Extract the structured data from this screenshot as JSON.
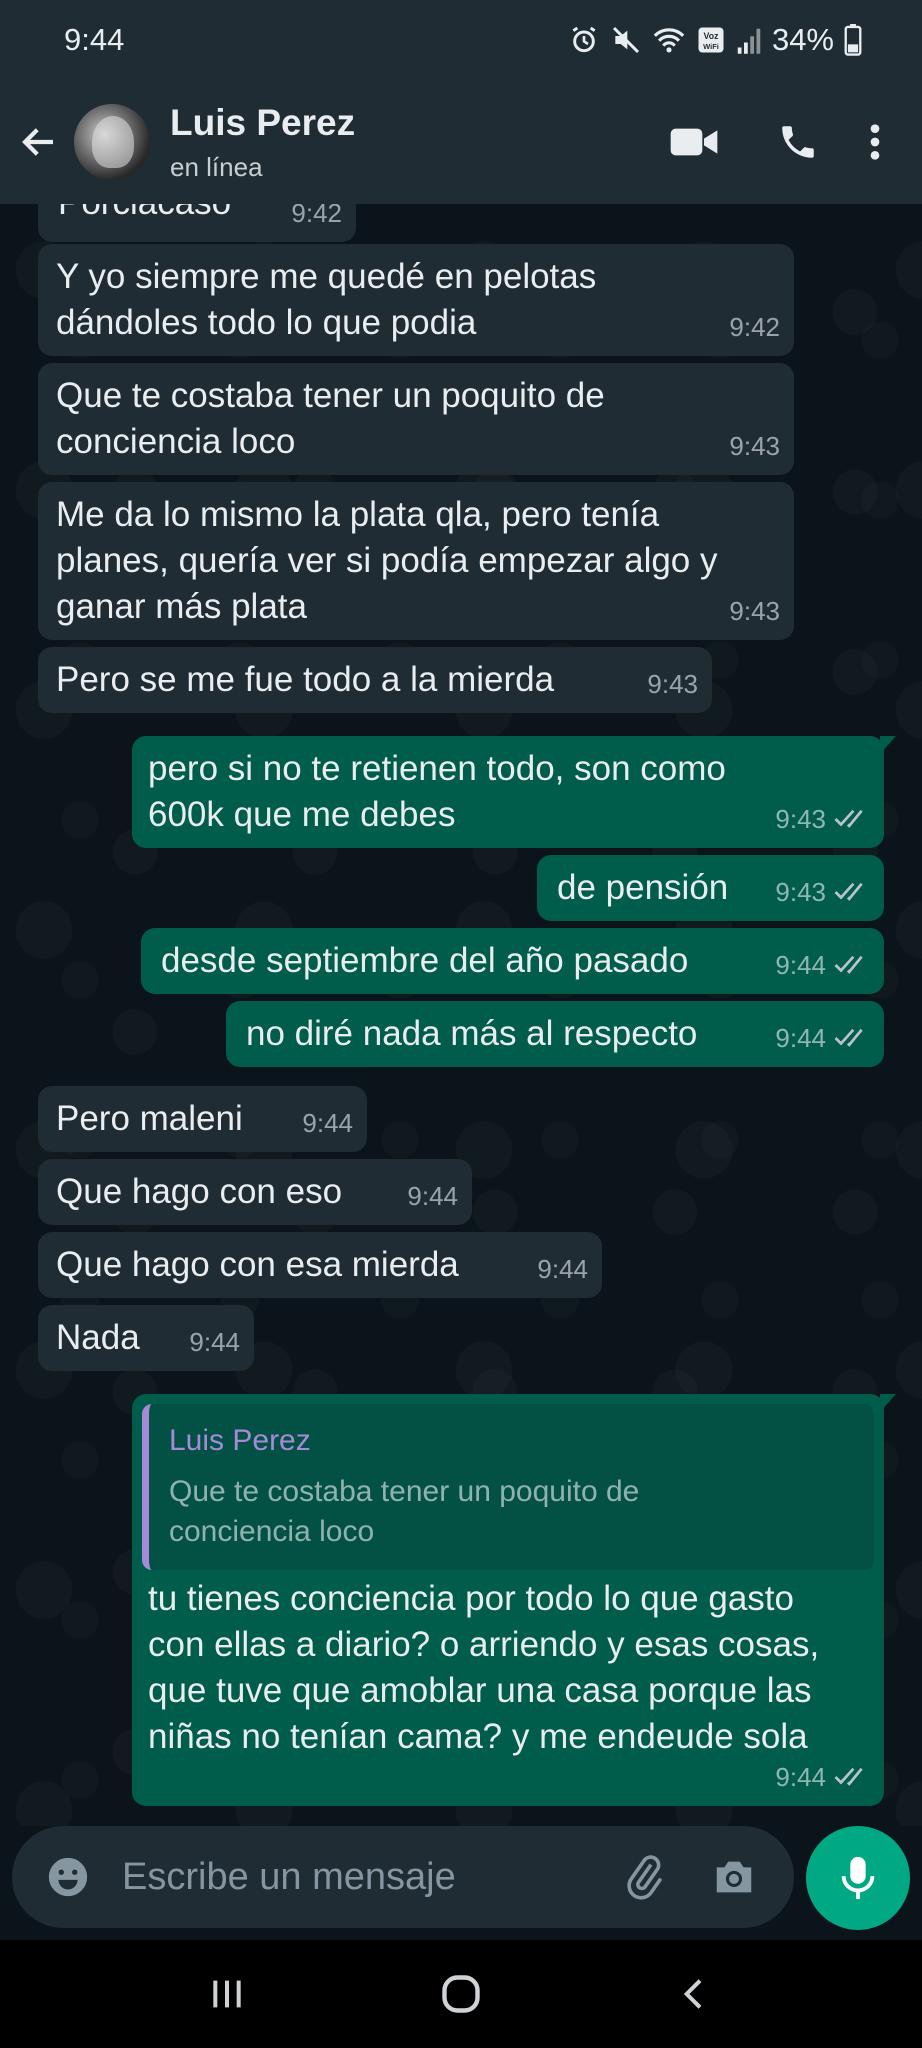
{
  "status_bar": {
    "time": "9:44",
    "battery": "34%",
    "icons": [
      "alarm-icon",
      "mute-icon",
      "wifi-icon",
      "volte-icon",
      "signal-icon",
      "battery-icon"
    ]
  },
  "header": {
    "contact_name": "Luis Perez",
    "contact_status": "en línea",
    "icons": [
      "back-arrow-icon",
      "video-call-icon",
      "phone-icon",
      "more-vert-icon"
    ]
  },
  "messages": [
    {
      "dir": "in",
      "text": "Porciacaso",
      "time": "9:42"
    },
    {
      "dir": "in",
      "text": "Y yo siempre me quedé en pelotas dándoles todo lo que podia",
      "time": "9:42"
    },
    {
      "dir": "in",
      "text": "Que te costaba tener un poquito de conciencia loco",
      "time": "9:43"
    },
    {
      "dir": "in",
      "text": "Me da lo mismo la plata qla, pero tenía planes, quería ver si podía empezar algo y ganar más plata",
      "time": "9:43"
    },
    {
      "dir": "in",
      "text": "Pero se me fue todo a la mierda",
      "time": "9:43"
    },
    {
      "dir": "out",
      "text": "pero si no te retienen todo, son como 600k que me debes",
      "time": "9:43",
      "read": true
    },
    {
      "dir": "out",
      "text": "de pensión",
      "time": "9:43",
      "read": true
    },
    {
      "dir": "out",
      "text": "desde septiembre del año pasado",
      "time": "9:44",
      "read": true
    },
    {
      "dir": "out",
      "text": "no diré nada más al respecto",
      "time": "9:44",
      "read": true
    },
    {
      "dir": "in",
      "text": "Pero maleni",
      "time": "9:44"
    },
    {
      "dir": "in",
      "text": "Que hago con eso",
      "time": "9:44"
    },
    {
      "dir": "in",
      "text": "Que hago con esa mierda",
      "time": "9:44"
    },
    {
      "dir": "in",
      "text": "Nada",
      "time": "9:44"
    },
    {
      "dir": "out",
      "quote_author": "Luis Perez",
      "quote_text": "Que te costaba tener un poquito de conciencia loco",
      "text": "tu tienes conciencia por todo lo que gasto con ellas a diario? o arriendo y esas cosas, que tuve que amoblar una casa porque las niñas no tenían cama? y me endeude sola",
      "time": "9:44",
      "read": true
    }
  ],
  "composer": {
    "placeholder": "Escribe un mensaje",
    "icons": [
      "emoji-icon",
      "attach-icon",
      "camera-icon",
      "mic-icon"
    ]
  },
  "nav_bar": {
    "icons": [
      "recent-apps-icon",
      "home-icon",
      "back-icon"
    ]
  },
  "colors": {
    "header_bg": "#1f2c34",
    "chat_bg": "#0b141a",
    "incoming_bubble": "#1f2c34",
    "outgoing_bubble": "#005c4b",
    "accent": "#00a884",
    "quote_author": "#a58ad8"
  }
}
